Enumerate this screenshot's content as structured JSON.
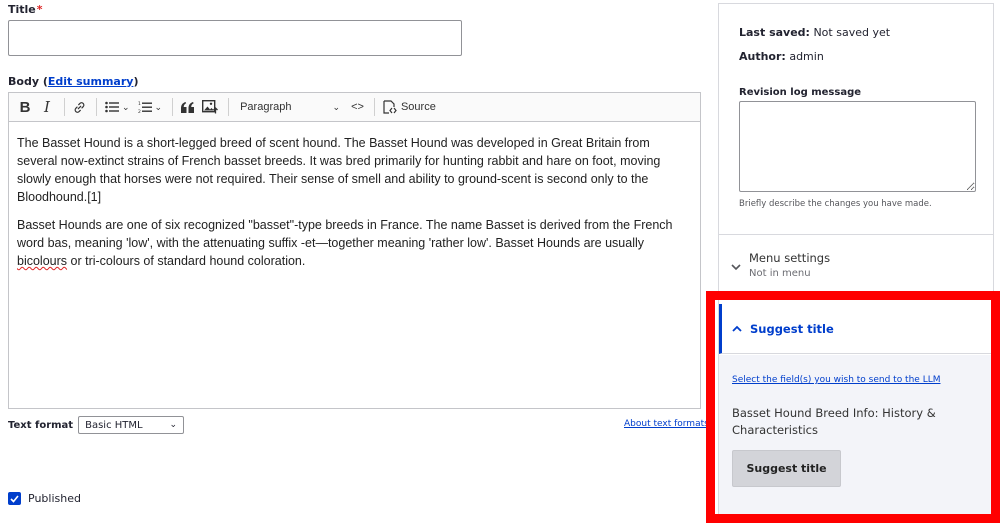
{
  "title_field": {
    "label": "Title",
    "required_mark": "*",
    "value": ""
  },
  "body_field": {
    "label": "Body",
    "edit_summary_link": "Edit summary"
  },
  "toolbar": {
    "bold": "B",
    "italic": "I",
    "paragraph_format": "Paragraph",
    "source_label": "Source"
  },
  "body_content": {
    "paragraph1": "The Basset Hound is a short-legged breed of scent hound. The Basset Hound was developed in Great Britain from several now-extinct strains of French basset breeds. It was bred primarily for hunting rabbit and hare on foot, moving slowly enough that horses were not required. Their sense of smell and ability to ground-scent is second only to the Bloodhound.[1]",
    "paragraph2_before": "Basset Hounds are one of six recognized \"basset\"-type breeds in France. The name Basset is derived from the French word bas, meaning 'low', with the attenuating suffix -et—together meaning 'rather low'. Basset Hounds are usually ",
    "paragraph2_misspelled": "bicolours",
    "paragraph2_after": " or tri-colours of standard hound coloration."
  },
  "text_format": {
    "label": "Text format",
    "selected": "Basic HTML",
    "about_link": "About text formats"
  },
  "published": {
    "label": "Published",
    "checked": true
  },
  "sidebar": {
    "last_saved_label": "Last saved:",
    "last_saved_value": "Not saved yet",
    "author_label": "Author:",
    "author_value": "admin",
    "revision_label": "Revision log message",
    "revision_value": "",
    "revision_help": "Briefly describe the changes you have made.",
    "menu_settings_title": "Menu settings",
    "menu_settings_sub": "Not in menu",
    "suggest_title_header": "Suggest title",
    "suggest_link": "Select the field(s) you wish to send to the LLM",
    "suggest_result": "Basset Hound Breed Info: History & Characteristics",
    "suggest_button": "Suggest title"
  },
  "colors": {
    "accent": "#003ecc",
    "highlight": "#ff0000",
    "required": "#dc2323"
  }
}
